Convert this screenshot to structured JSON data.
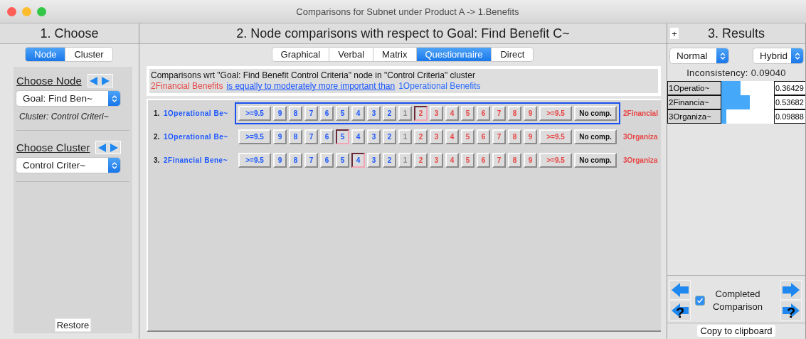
{
  "window": {
    "title": "Comparisons for Subnet under Product A -> 1.Benefits"
  },
  "choose_panel": {
    "heading": "1. Choose",
    "tabs": [
      {
        "label": "Node",
        "selected": true
      },
      {
        "label": "Cluster",
        "selected": false
      }
    ],
    "node_section": {
      "heading": "Choose Node",
      "select": "Goal: Find Ben~",
      "note": "Cluster: Control Criteri~"
    },
    "cluster_section": {
      "heading": "Choose Cluster",
      "select": "Control Criter~"
    },
    "restore_button": "Restore"
  },
  "comparison_panel": {
    "heading": "2. Node comparisons with respect to Goal: Find Benefit C~",
    "tabs": [
      {
        "label": "Graphical",
        "selected": false
      },
      {
        "label": "Verbal",
        "selected": false
      },
      {
        "label": "Matrix",
        "selected": false
      },
      {
        "label": "Questionnaire",
        "selected": true
      },
      {
        "label": "Direct",
        "selected": false
      }
    ],
    "description": "Comparisons wrt \"Goal: Find Benefit Control Criteria\" node in \"Control Criteria\" cluster",
    "verdict": {
      "left": "2Financial Benefits",
      "relation": "is equally to moderately more important than",
      "right": "1Operational Benefits"
    },
    "rows": [
      {
        "index": "1.",
        "left": "1Operational Be~",
        "right": "2Financial",
        "selected": true,
        "buttons": [
          {
            "label": ">=9.5",
            "kind": "left",
            "selected": false
          },
          {
            "label": "9",
            "kind": "left",
            "selected": false
          },
          {
            "label": "8",
            "kind": "left",
            "selected": false
          },
          {
            "label": "7",
            "kind": "left",
            "selected": false
          },
          {
            "label": "6",
            "kind": "left",
            "selected": false
          },
          {
            "label": "5",
            "kind": "left",
            "selected": false
          },
          {
            "label": "4",
            "kind": "left",
            "selected": false
          },
          {
            "label": "3",
            "kind": "left",
            "selected": false
          },
          {
            "label": "2",
            "kind": "left",
            "selected": false
          },
          {
            "label": "1",
            "kind": "center",
            "selected": false
          },
          {
            "label": "2",
            "kind": "right",
            "selected": true
          },
          {
            "label": "3",
            "kind": "right",
            "selected": false
          },
          {
            "label": "4",
            "kind": "right",
            "selected": false
          },
          {
            "label": "5",
            "kind": "right",
            "selected": false
          },
          {
            "label": "6",
            "kind": "right",
            "selected": false
          },
          {
            "label": "7",
            "kind": "right",
            "selected": false
          },
          {
            "label": "8",
            "kind": "right",
            "selected": false
          },
          {
            "label": "9",
            "kind": "right",
            "selected": false
          },
          {
            "label": ">=9.5",
            "kind": "right",
            "selected": false
          },
          {
            "label": "No comp.",
            "kind": "none",
            "selected": false
          }
        ]
      },
      {
        "index": "2.",
        "left": "1Operational Be~",
        "right": "3Organiza",
        "selected": false,
        "buttons": [
          {
            "label": ">=9.5",
            "kind": "left",
            "selected": false
          },
          {
            "label": "9",
            "kind": "left",
            "selected": false
          },
          {
            "label": "8",
            "kind": "left",
            "selected": false
          },
          {
            "label": "7",
            "kind": "left",
            "selected": false
          },
          {
            "label": "6",
            "kind": "left",
            "selected": false
          },
          {
            "label": "5",
            "kind": "left",
            "selected": true
          },
          {
            "label": "4",
            "kind": "left",
            "selected": false
          },
          {
            "label": "3",
            "kind": "left",
            "selected": false
          },
          {
            "label": "2",
            "kind": "left",
            "selected": false
          },
          {
            "label": "1",
            "kind": "center",
            "selected": false
          },
          {
            "label": "2",
            "kind": "right",
            "selected": false
          },
          {
            "label": "3",
            "kind": "right",
            "selected": false
          },
          {
            "label": "4",
            "kind": "right",
            "selected": false
          },
          {
            "label": "5",
            "kind": "right",
            "selected": false
          },
          {
            "label": "6",
            "kind": "right",
            "selected": false
          },
          {
            "label": "7",
            "kind": "right",
            "selected": false
          },
          {
            "label": "8",
            "kind": "right",
            "selected": false
          },
          {
            "label": "9",
            "kind": "right",
            "selected": false
          },
          {
            "label": ">=9.5",
            "kind": "right",
            "selected": false
          },
          {
            "label": "No comp.",
            "kind": "none",
            "selected": false
          }
        ]
      },
      {
        "index": "3.",
        "left": "2Financial Bene~",
        "right": "3Organiza",
        "selected": false,
        "buttons": [
          {
            "label": ">=9.5",
            "kind": "left",
            "selected": false
          },
          {
            "label": "9",
            "kind": "left",
            "selected": false
          },
          {
            "label": "8",
            "kind": "left",
            "selected": false
          },
          {
            "label": "7",
            "kind": "left",
            "selected": false
          },
          {
            "label": "6",
            "kind": "left",
            "selected": false
          },
          {
            "label": "5",
            "kind": "left",
            "selected": false
          },
          {
            "label": "4",
            "kind": "left",
            "selected": true
          },
          {
            "label": "3",
            "kind": "left",
            "selected": false
          },
          {
            "label": "2",
            "kind": "left",
            "selected": false
          },
          {
            "label": "1",
            "kind": "center",
            "selected": false
          },
          {
            "label": "2",
            "kind": "right",
            "selected": false
          },
          {
            "label": "3",
            "kind": "right",
            "selected": false
          },
          {
            "label": "4",
            "kind": "right",
            "selected": false
          },
          {
            "label": "5",
            "kind": "right",
            "selected": false
          },
          {
            "label": "6",
            "kind": "right",
            "selected": false
          },
          {
            "label": "7",
            "kind": "right",
            "selected": false
          },
          {
            "label": "8",
            "kind": "right",
            "selected": false
          },
          {
            "label": "9",
            "kind": "right",
            "selected": false
          },
          {
            "label": ">=9.5",
            "kind": "right",
            "selected": false
          },
          {
            "label": "No comp.",
            "kind": "none",
            "selected": false
          }
        ]
      }
    ]
  },
  "results_panel": {
    "add_button": "+",
    "heading": "3. Results",
    "mode_select": "Normal",
    "type_select": "Hybrid",
    "inconsistency": "Inconsistency: 0.09040",
    "rows": [
      {
        "label": "1Operatio~",
        "level": 0.364,
        "value": "0.36429"
      },
      {
        "label": "2Financia~",
        "level": 0.537,
        "value": "0.53682"
      },
      {
        "label": "3Organiza~",
        "level": 0.099,
        "value": "0.09888"
      }
    ],
    "nav_buttons": [
      {
        "kind": "back"
      },
      {
        "kind": "forward"
      },
      {
        "kind": "back",
        "mark": "?"
      },
      {
        "kind": "forward",
        "mark": "?"
      }
    ],
    "completed": {
      "label": "Completed Comparison",
      "checked": true
    },
    "copy_button": "Copy to clipboard"
  }
}
